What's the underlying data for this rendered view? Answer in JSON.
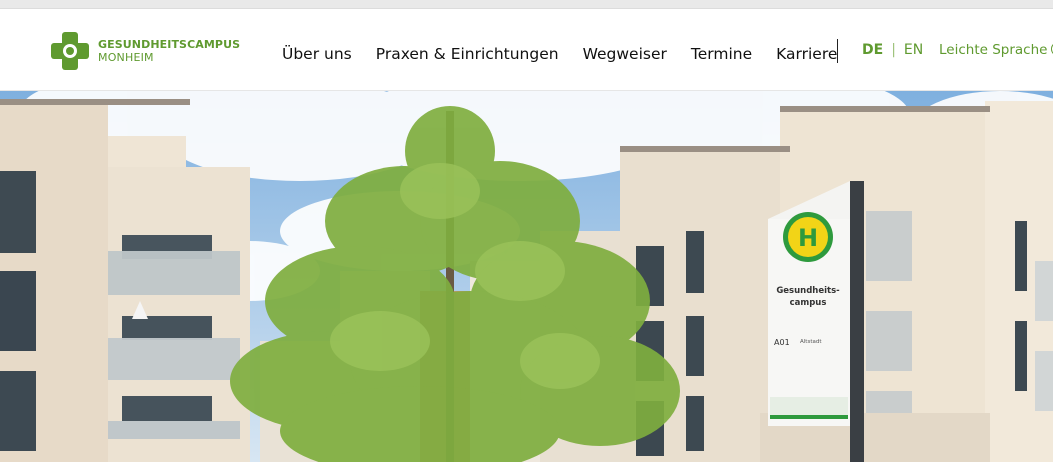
{
  "brand": {
    "name_line1": "GESUNDHEITSCAMPUS",
    "name_line2": "MONHEIM",
    "color": "#5f9a2f"
  },
  "nav": {
    "items": [
      {
        "label": "Über uns",
        "active": true
      },
      {
        "label": "Praxen & Einrichtungen",
        "active": false
      },
      {
        "label": "Wegweiser",
        "active": false
      },
      {
        "label": "Termine",
        "active": false
      },
      {
        "label": "Karriere",
        "active": false
      }
    ]
  },
  "language": {
    "current": "DE",
    "other": "EN",
    "separator": "|"
  },
  "easy_language": {
    "label": "Leichte Sprache",
    "icon": "easy-language-icon"
  },
  "hero": {
    "sign": {
      "symbol": "H",
      "line1": "Gesundheits-",
      "line2": "campus",
      "code": "A01",
      "district": "Altstadt"
    }
  }
}
